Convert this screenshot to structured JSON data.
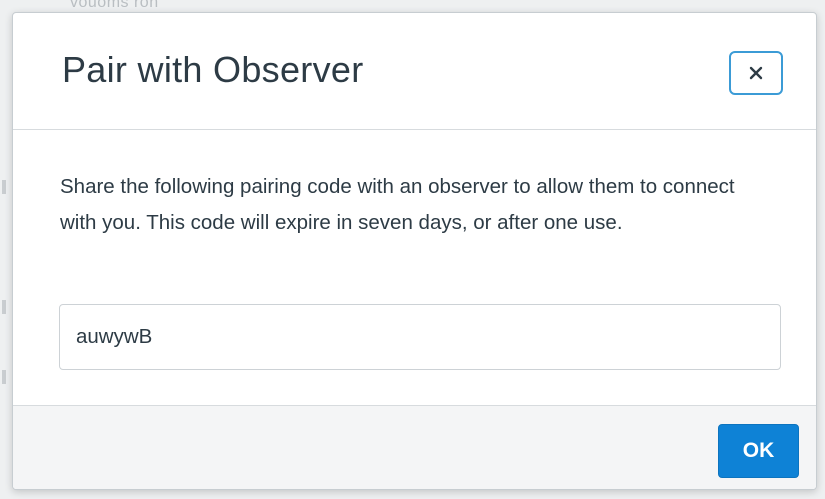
{
  "backdrop": {
    "text": "vouoms  ron"
  },
  "dialog": {
    "title": "Pair with Observer",
    "close_icon": "close-icon",
    "description": "Share the following pairing code with an observer to allow them to connect with you. This code will expire in seven days, or after one use.",
    "pairing_code": "auwywB",
    "ok_label": "OK"
  },
  "colors": {
    "accent": "#0e82d6",
    "close_border": "#3b9bd6",
    "text": "#2d3b45",
    "footer_bg": "#f4f5f6"
  }
}
